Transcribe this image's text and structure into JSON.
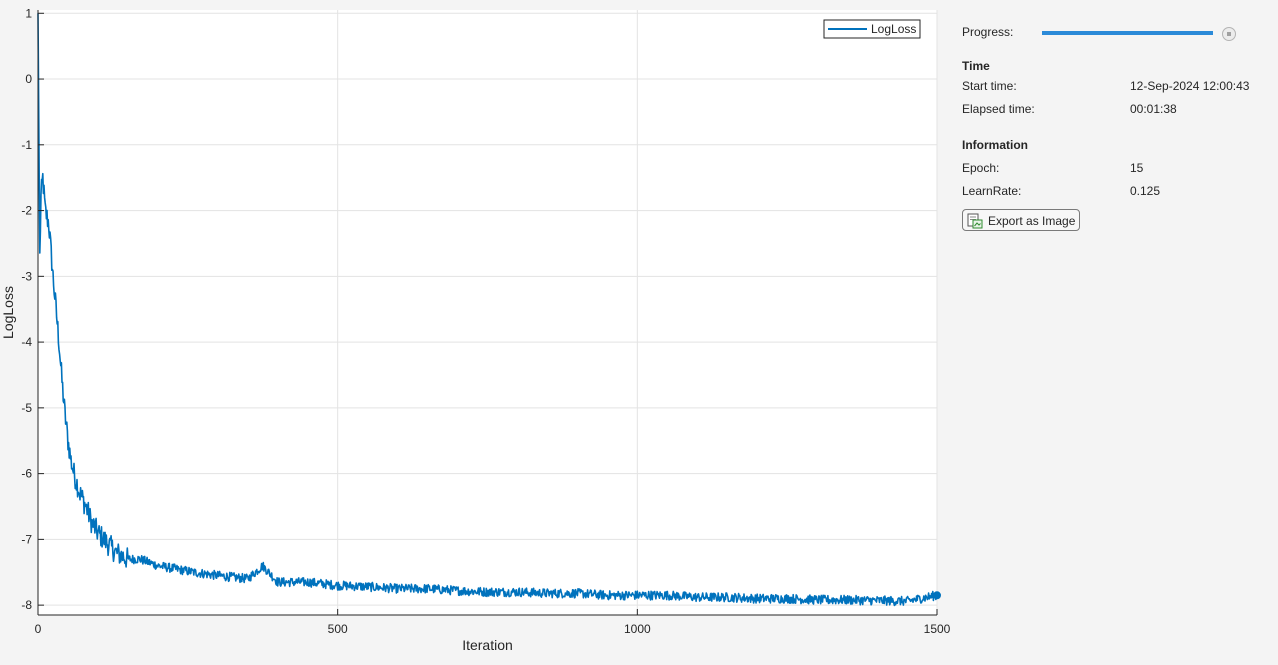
{
  "colors": {
    "series": "#0072bd",
    "progress": "#2b8ad8",
    "grid": "#e3e3e3",
    "axis": "#262626"
  },
  "progress": {
    "label": "Progress:",
    "fraction": 1.0
  },
  "time": {
    "title": "Time",
    "start_label": "Start time:",
    "start_value": "12-Sep-2024 12:00:43",
    "elapsed_label": "Elapsed time:",
    "elapsed_value": "00:01:38"
  },
  "information": {
    "title": "Information",
    "epoch_label": "Epoch:",
    "epoch_value": "15",
    "learnrate_label": "LearnRate:",
    "learnrate_value": "0.125"
  },
  "export_button": {
    "label": "Export as Image",
    "icon": "export-image-icon"
  },
  "chart_data": {
    "type": "line",
    "xlabel": "Iteration",
    "ylabel": "LogLoss",
    "xlim": [
      0,
      1500
    ],
    "ylim": [
      -8.15,
      1.05
    ],
    "xticks": [
      0,
      500,
      1000,
      1500
    ],
    "yticks": [
      1,
      0,
      -1,
      -2,
      -3,
      -4,
      -5,
      -6,
      -7,
      -8
    ],
    "grid": true,
    "legend": "top-right",
    "series": [
      {
        "name": "LogLoss",
        "x": [
          0,
          3,
          5,
          8,
          12,
          18,
          25,
          30,
          35,
          40,
          45,
          50,
          55,
          60,
          70,
          80,
          90,
          100,
          110,
          120,
          130,
          140,
          150,
          170,
          200,
          230,
          260,
          300,
          350,
          375,
          400,
          450,
          500,
          550,
          600,
          650,
          700,
          750,
          800,
          850,
          900,
          950,
          1000,
          1050,
          1100,
          1150,
          1200,
          1250,
          1300,
          1350,
          1400,
          1450,
          1500
        ],
        "y": [
          1.0,
          -2.7,
          -1.8,
          -1.5,
          -2.0,
          -2.2,
          -3.0,
          -3.5,
          -4.0,
          -4.6,
          -5.1,
          -5.5,
          -5.8,
          -6.0,
          -6.3,
          -6.5,
          -6.75,
          -6.9,
          -7.0,
          -7.1,
          -7.2,
          -7.25,
          -7.3,
          -7.3,
          -7.4,
          -7.45,
          -7.5,
          -7.55,
          -7.6,
          -7.4,
          -7.65,
          -7.65,
          -7.7,
          -7.72,
          -7.75,
          -7.75,
          -7.78,
          -7.8,
          -7.8,
          -7.82,
          -7.82,
          -7.85,
          -7.85,
          -7.85,
          -7.88,
          -7.88,
          -7.9,
          -7.9,
          -7.92,
          -7.92,
          -7.93,
          -7.94,
          -7.85
        ]
      }
    ]
  }
}
